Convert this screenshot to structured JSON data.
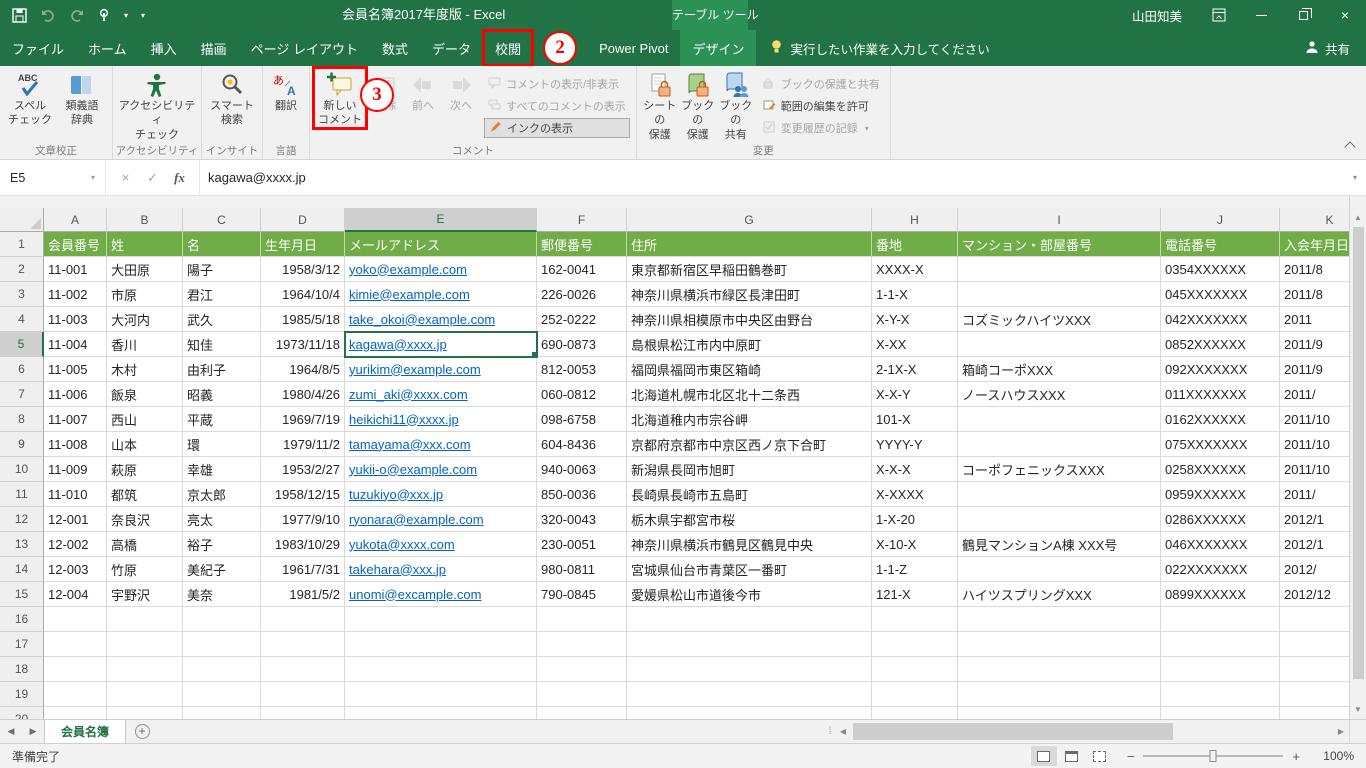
{
  "title_bar": {
    "title": "会員名簿2017年度版  -  Excel",
    "context_label": "テーブル ツール",
    "user_name": "山田知美"
  },
  "tab_bar": {
    "search_prompt": "実行したい作業を入力してください",
    "share_label": "共有"
  },
  "ribbon_tabs": [
    {
      "id": "file",
      "label": "ファイル",
      "file": true
    },
    {
      "id": "home",
      "label": "ホーム"
    },
    {
      "id": "insert",
      "label": "挿入"
    },
    {
      "id": "draw",
      "label": "描画"
    },
    {
      "id": "page-layout",
      "label": "ページ レイアウト"
    },
    {
      "id": "formulas",
      "label": "数式"
    },
    {
      "id": "data",
      "label": "データ"
    },
    {
      "id": "review",
      "label": "校閲",
      "boxed": true,
      "annotation_after": true
    },
    {
      "id": "power-pivot",
      "label": "Power Pivot"
    },
    {
      "id": "design",
      "label": "デザイン",
      "contextual": true
    }
  ],
  "annotations": {
    "step_2": "2",
    "step_3": "3"
  },
  "ribbon": {
    "groups": [
      {
        "label": "文章校正"
      },
      {
        "label": "アクセシビリティ"
      },
      {
        "label": "インサイト"
      },
      {
        "label": "言語"
      },
      {
        "label": "コメント"
      },
      {
        "label": "変更"
      }
    ],
    "buttons": {
      "spell": {
        "l1": "スペル",
        "l2": "チェック"
      },
      "thesaurus": {
        "l1": "類義語",
        "l2": "辞典"
      },
      "accessibility": {
        "l1": "アクセシビリティ",
        "l2": "チェック"
      },
      "smart": {
        "l1": "スマート",
        "l2": "検索"
      },
      "translate": {
        "l1": "翻訳",
        "l2": ""
      },
      "new_comment": {
        "l1": "新しい",
        "l2": "コメント"
      },
      "delete": {
        "l1": "削除",
        "l2": ""
      },
      "prev": {
        "l1": "前へ",
        "l2": ""
      },
      "next": {
        "l1": "次へ",
        "l2": ""
      },
      "show_hide_comment": "コメントの表示/非表示",
      "show_all_comments": "すべてのコメントの表示",
      "show_ink": "インクの表示",
      "protect_sheet": {
        "l1": "シートの",
        "l2": "保護"
      },
      "protect_book": {
        "l1": "ブックの",
        "l2": "保護"
      },
      "share_book": {
        "l1": "ブックの",
        "l2": "共有"
      },
      "protect_share": "ブックの保護と共有",
      "allow_edit": "範囲の編集を許可",
      "track_changes": "変更履歴の記録"
    }
  },
  "formula_bar": {
    "name_box": "E5",
    "formula": "kagawa@xxxx.jp"
  },
  "sheet": {
    "columns": [
      "A",
      "B",
      "C",
      "D",
      "E",
      "F",
      "G",
      "H",
      "I",
      "J",
      "K"
    ],
    "visible_rows": 20,
    "selection": {
      "column": "E",
      "row": 5,
      "cell": "E5"
    },
    "header_row": [
      "会員番号",
      "姓",
      "名",
      "生年月日",
      "メールアドレス",
      "郵便番号",
      "住所",
      "番地",
      "マンション・部屋番号",
      "電話番号",
      "入会年月日"
    ],
    "rows": [
      [
        "11-001",
        "大田原",
        "陽子",
        "1958/3/12",
        "yoko@example.com",
        "162-0041",
        "東京都新宿区早稲田鶴巻町",
        "XXXX-X",
        "",
        "0354XXXXXX",
        "2011/8"
      ],
      [
        "11-002",
        "市原",
        "君江",
        "1964/10/4",
        "kimie@example.com",
        "226-0026",
        "神奈川県横浜市緑区長津田町",
        "1-1-X",
        "",
        "045XXXXXXX",
        "2011/8"
      ],
      [
        "11-003",
        "大河内",
        "武久",
        "1985/5/18",
        "take_okoi@example.com",
        "252-0222",
        "神奈川県相模原市中央区由野台",
        "X-Y-X",
        "コズミックハイツXXX",
        "042XXXXXXX",
        "2011"
      ],
      [
        "11-004",
        "香川",
        "知佳",
        "1973/11/18",
        "kagawa@xxxx.jp",
        "690-0873",
        "島根県松江市内中原町",
        "X-XX",
        "",
        "0852XXXXXX",
        "2011/9"
      ],
      [
        "11-005",
        "木村",
        "由利子",
        "1964/8/5",
        "yurikim@example.com",
        "812-0053",
        "福岡県福岡市東区箱崎",
        "2-1X-X",
        "箱崎コーポXXX",
        "092XXXXXXX",
        "2011/9"
      ],
      [
        "11-006",
        "飯泉",
        "昭義",
        "1980/4/26",
        "zumi_aki@xxxx.com",
        "060-0812",
        "北海道札幌市北区北十二条西",
        "X-X-Y",
        "ノースハウスXXX",
        "011XXXXXXX",
        "2011/"
      ],
      [
        "11-007",
        "西山",
        "平蔵",
        "1969/7/19",
        "heikichi11@xxxx.jp",
        "098-6758",
        "北海道稚内市宗谷岬",
        "101-X",
        "",
        "0162XXXXXX",
        "2011/10"
      ],
      [
        "11-008",
        "山本",
        "環",
        "1979/11/2",
        "tamayama@xxx.com",
        "604-8436",
        "京都府京都市中京区西ノ京下合町",
        "YYYY-Y",
        "",
        "075XXXXXXX",
        "2011/10"
      ],
      [
        "11-009",
        "萩原",
        "幸雄",
        "1953/2/27",
        "yukii-o@example.com",
        "940-0063",
        "新潟県長岡市旭町",
        "X-X-X",
        "コーポフェニックスXXX",
        "0258XXXXXX",
        "2011/10"
      ],
      [
        "11-010",
        "都筑",
        "京太郎",
        "1958/12/15",
        "tuzukiyo@xxx.jp",
        "850-0036",
        "長崎県長崎市五島町",
        "X-XXXX",
        "",
        "0959XXXXXX",
        "2011/"
      ],
      [
        "12-001",
        "奈良沢",
        "亮太",
        "1977/9/10",
        "ryonara@example.com",
        "320-0043",
        "栃木県宇都宮市桜",
        "1-X-20",
        "",
        "0286XXXXXX",
        "2012/1"
      ],
      [
        "12-002",
        "高橋",
        "裕子",
        "1983/10/29",
        "yukota@xxxx.com",
        "230-0051",
        "神奈川県横浜市鶴見区鶴見中央",
        "X-10-X",
        "鶴見マンションA棟 XXX号",
        "046XXXXXXX",
        "2012/1"
      ],
      [
        "12-003",
        "竹原",
        "美紀子",
        "1961/7/31",
        "takehara@xxx.jp",
        "980-0811",
        "宮城県仙台市青葉区一番町",
        "1-1-Z",
        "",
        "022XXXXXXX",
        "2012/"
      ],
      [
        "12-004",
        "宇野沢",
        "美奈",
        "1981/5/2",
        "unomi@excample.com",
        "790-0845",
        "愛媛県松山市道後今市",
        "121-X",
        "ハイツスプリングXXX",
        "0899XXXXXX",
        "2012/12"
      ]
    ]
  },
  "sheet_tabs": {
    "active": "会員名簿"
  },
  "status_bar": {
    "ready": "準備完了",
    "zoom": "100%"
  }
}
